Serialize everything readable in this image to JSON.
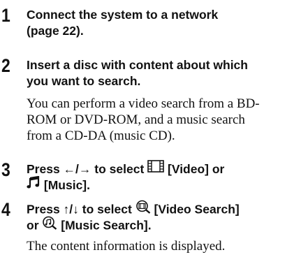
{
  "steps": [
    {
      "number": "1",
      "heading_lines": [
        "Connect the system to a network",
        "(page 22)."
      ]
    },
    {
      "number": "2",
      "heading_lines": [
        "Insert a disc with content about which",
        "you want to search."
      ],
      "body_lines": [
        "You can perform a video search from a BD-",
        "ROM or DVD-ROM, and a music search",
        "from a CD-DA (music CD)."
      ]
    },
    {
      "number": "3",
      "heading": {
        "line1_prefix": "Press ←/→ to select ",
        "video_label": "[Video] or",
        "music_label": "[Music]."
      },
      "icons": [
        "film-icon",
        "music-note-icon"
      ]
    },
    {
      "number": "4",
      "heading": {
        "line1_prefix": "Press ↑/↓ to select ",
        "video_search_label": "[Video Search]",
        "line2_prefix": "or ",
        "music_search_label": "[Music Search]."
      },
      "icons": [
        "video-search-icon",
        "music-search-icon"
      ],
      "body_lines": [
        "The content information is displayed."
      ]
    }
  ]
}
